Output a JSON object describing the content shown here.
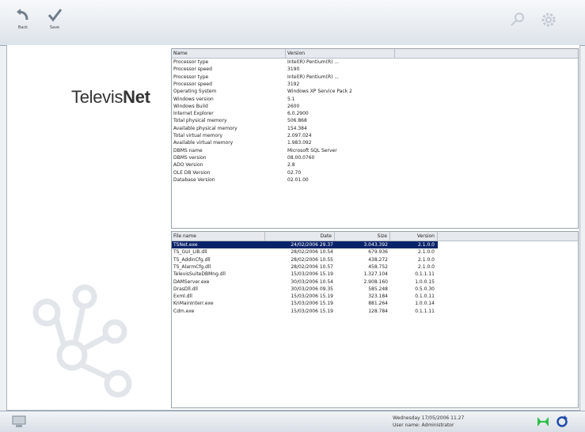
{
  "toolbar": {
    "back_label": "Back",
    "save_label": "Save",
    "right_icons": [
      "pin-icon",
      "gear-icon"
    ]
  },
  "brand": {
    "part1": "Televis",
    "part2": "Net"
  },
  "system_info": {
    "headers": [
      "Name",
      "Version"
    ],
    "rows": [
      [
        "Processor type",
        "Intel(R) Pentium(R) ..."
      ],
      [
        "Processor speed",
        "3190"
      ],
      [
        "Processor type",
        "Intel(R) Pentium(R) ..."
      ],
      [
        "Processor speed",
        "3192"
      ],
      [
        "Operating System",
        "Windows XP Service Pack 2"
      ],
      [
        "Windows version",
        "5.1"
      ],
      [
        "Windows Build",
        "2600"
      ],
      [
        "Internet Explorer",
        "6.0.2900"
      ],
      [
        "Total physical memory",
        "506.868"
      ],
      [
        "Available physical memory",
        "154.384"
      ],
      [
        "Total virtual memory",
        "2.097.024"
      ],
      [
        "Available virtual memory",
        "1.983.092"
      ],
      [
        "DBMS name",
        "Microsoft SQL Server"
      ],
      [
        "DBMS version",
        "08.00.0760"
      ],
      [
        "ADO Version",
        "2.8"
      ],
      [
        "OLE DB Version",
        "02.70"
      ],
      [
        "Database Version",
        "02.01.00"
      ]
    ]
  },
  "files": {
    "headers": [
      "File name",
      "Date",
      "Size",
      "Version"
    ],
    "rows": [
      [
        "TSNet.exe",
        "24/02/2006 29.37",
        "3.043.392",
        "2.1.0.0"
      ],
      [
        "TS_GUI_LIB.dll",
        "28/02/2006 10.54",
        "679.936",
        "2.1.0.0"
      ],
      [
        "TS_AddinCfg.dll",
        "28/02/2006 10.55",
        "438.272",
        "2.1.0.0"
      ],
      [
        "TS_AlarmCfg.dll",
        "28/02/2006 10.57",
        "458.752",
        "2.1.0.0"
      ],
      [
        "TelevisSuiteDBMng.dll",
        "15/03/2006 15.19",
        "1.327.104",
        "0.1.1.11"
      ],
      [
        "DAMServer.exe",
        "30/03/2006 10.54",
        "2.908.160",
        "1.0.0.15"
      ],
      [
        "DrasDll.dll",
        "30/03/2006 09.35",
        "585.248",
        "0.5.0.30"
      ],
      [
        "Exml.dll",
        "15/03/2006 15.19",
        "323.184",
        "0.1.0.11"
      ],
      [
        "KnMainInterr.exe",
        "15/03/2006 15.19",
        "881.264",
        "1.0.0.14"
      ],
      [
        "Cdm.exe",
        "15/03/2006 15.19",
        "128.784",
        "0.1.1.11"
      ]
    ]
  },
  "status": {
    "line1": "Wednesday  17/05/2006    11.27",
    "line2": "User name: Administrator"
  }
}
